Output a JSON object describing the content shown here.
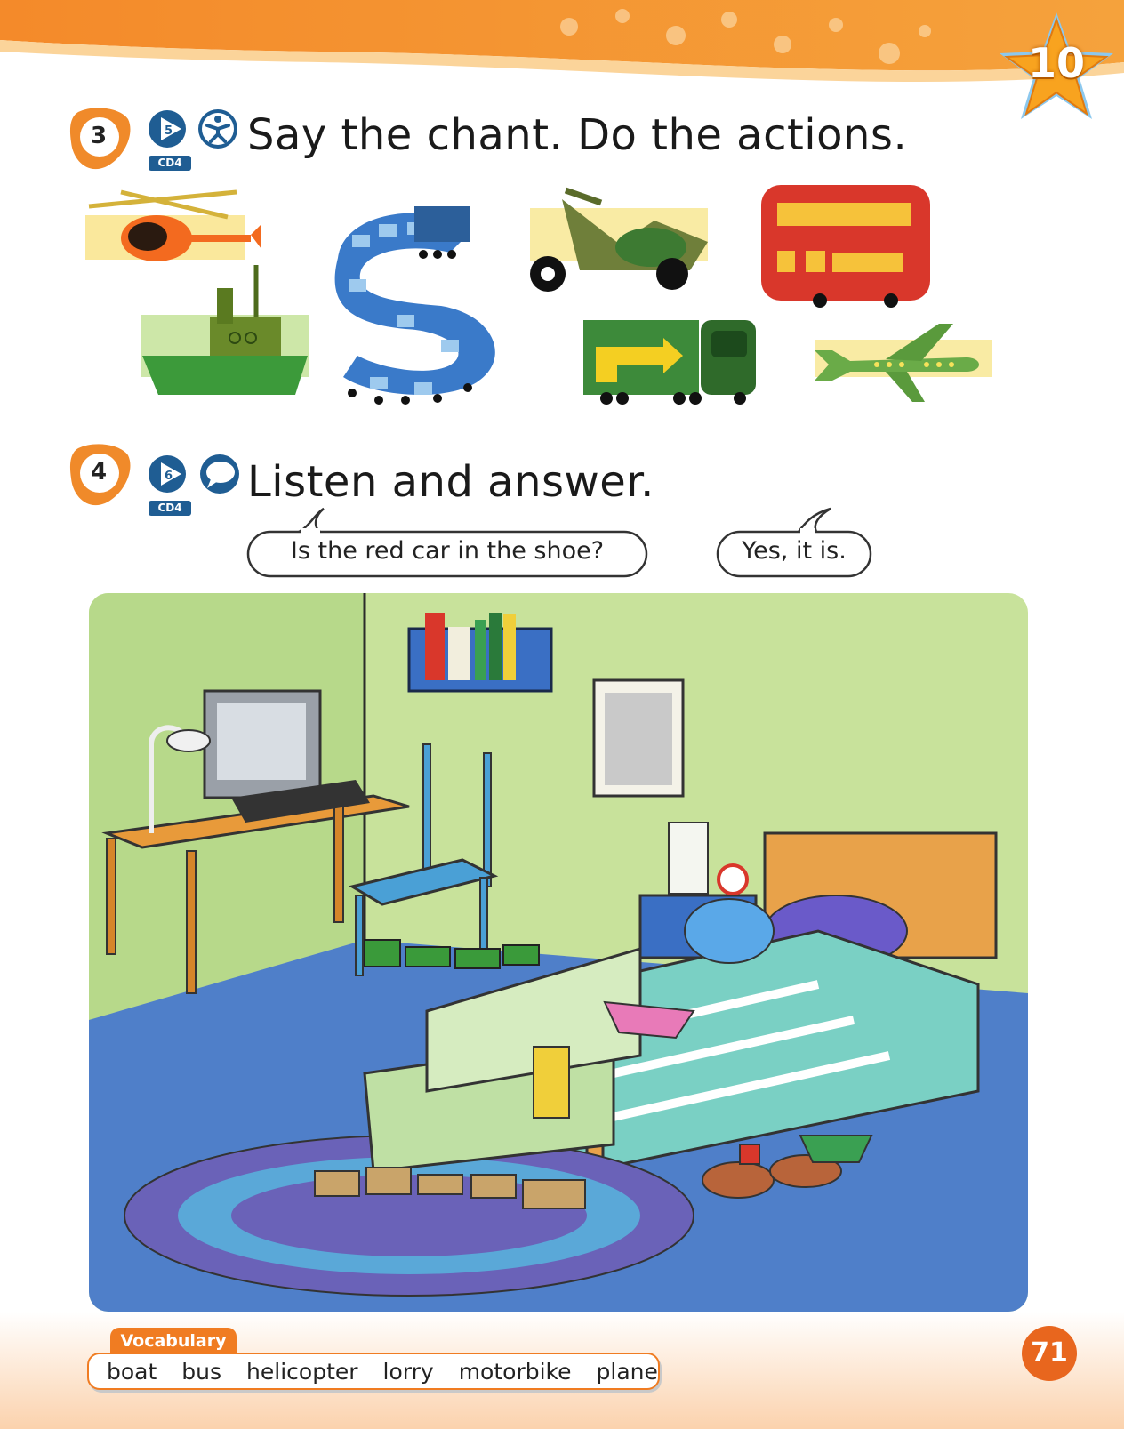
{
  "unit": {
    "number": "10"
  },
  "exercise3": {
    "number": "3",
    "track": "5",
    "cd": "CD4",
    "title": "Say the chant. Do the actions.",
    "icons": [
      "audio-play-icon",
      "action-person-icon"
    ]
  },
  "exercise4": {
    "number": "4",
    "track": "6",
    "cd": "CD4",
    "title": "Listen and answer.",
    "icons": [
      "audio-play-icon",
      "speech-bubble-icon"
    ],
    "bubbles": [
      {
        "text": "Is the red car in the shoe?"
      },
      {
        "text": "Yes, it is."
      }
    ]
  },
  "vocabulary": {
    "label": "Vocabulary",
    "words": [
      "boat",
      "bus",
      "helicopter",
      "lorry",
      "motorbike",
      "plane"
    ]
  },
  "page": {
    "number": "71"
  },
  "colors": {
    "accent_orange": "#f07c22",
    "cd_blue": "#1f5d93",
    "room_wall": "#c8e29b",
    "room_floor": "#4f7fc9"
  }
}
